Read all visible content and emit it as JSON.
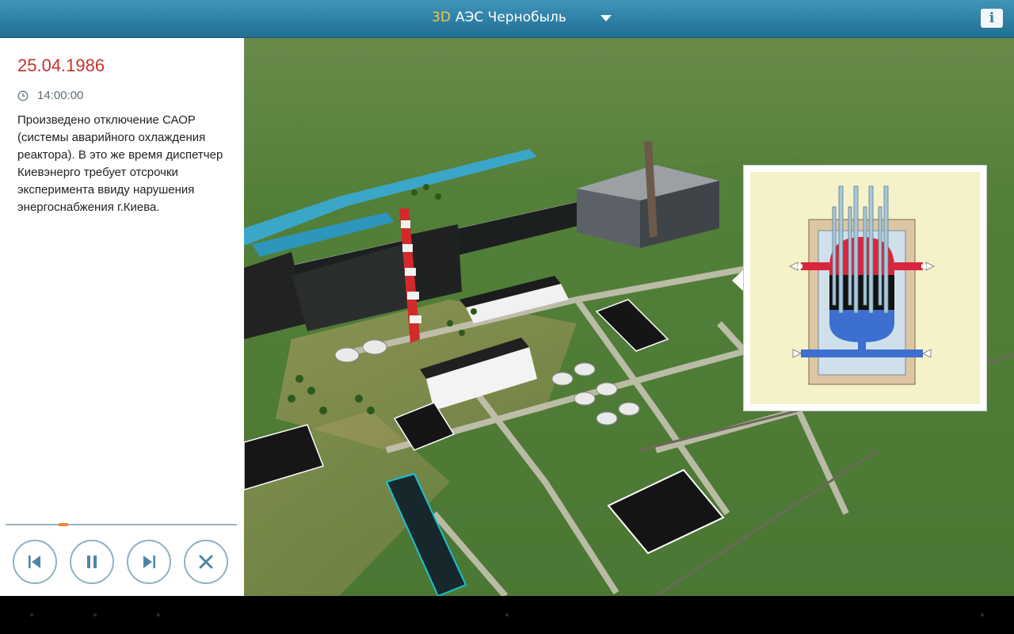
{
  "header": {
    "title_prefix": "3D",
    "title": "АЭС Чернобыль",
    "info_label": "i"
  },
  "event": {
    "date": "25.04.1986",
    "time": "14:00:00",
    "description": "Произведено отключение САОР (системы аварийного охлаждения реактора). В это же время диспетчер Киевэнерго требует отсрочки эксперимента ввиду нарушения энергоснабжения г.Киева."
  },
  "playback": {
    "progress": 0.25,
    "controls": [
      "previous",
      "pause",
      "next",
      "close"
    ]
  },
  "colors": {
    "header": "#2e7fa4",
    "date": "#c8322e",
    "title_prefix": "#f2c84b",
    "progress": "#f08a3c"
  }
}
